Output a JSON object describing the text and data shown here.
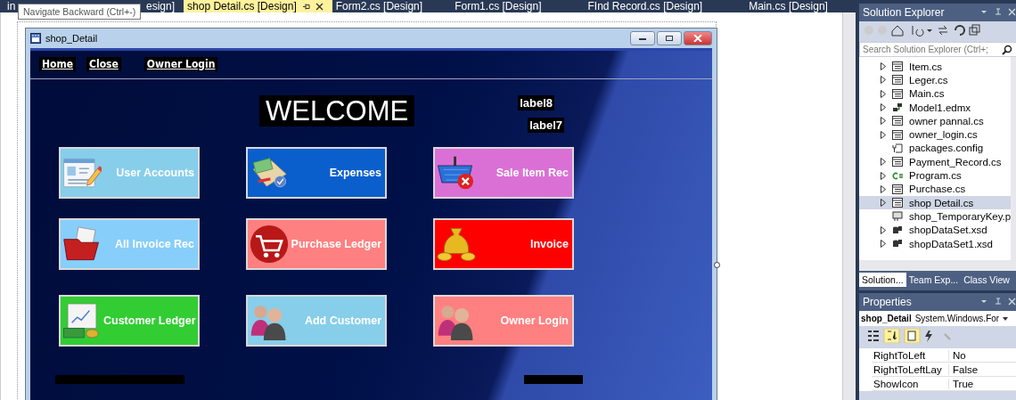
{
  "document_tabs": [
    {
      "label_start": "in",
      "label_end": "esign]",
      "selected": false
    },
    {
      "label": "shop Detail.cs [Design]",
      "selected": true
    },
    {
      "label": "Form2.cs [Design]",
      "selected": false
    },
    {
      "label": "Form1.cs [Design]",
      "selected": false
    },
    {
      "label": "FInd Record.cs [Design]",
      "selected": false
    },
    {
      "label": "Main.cs [Design]",
      "selected": false
    }
  ],
  "tooltip": "Navigate Backward (Ctrl+-)",
  "form": {
    "title": "shop_Detail",
    "menu": [
      "Home",
      "Close",
      "Owner Login"
    ],
    "welcome": "WELCOME",
    "label_a": "label8",
    "label_b": "label7",
    "buttons": [
      {
        "label": "User Accounts",
        "color": "#87ceeb",
        "kind": "card"
      },
      {
        "label": "Expenses",
        "color": "#0a5fcc",
        "kind": "envelope"
      },
      {
        "label": "Sale Item Rec",
        "color": "#da70d6",
        "kind": "basket"
      },
      {
        "label": "All Invoice Rec",
        "color": "#87cefa",
        "kind": "folder"
      },
      {
        "label": "Purchase Ledger",
        "color": "#ff8080",
        "kind": "cart"
      },
      {
        "label": "Invoice",
        "color": "#ff0000",
        "kind": "moneybag"
      },
      {
        "label": "Customer Ledger",
        "color": "#32cd32",
        "kind": "chart"
      },
      {
        "label": "Add Customer",
        "color": "#87ceeb",
        "kind": "people"
      },
      {
        "label": "Owner Login",
        "color": "#ff8080",
        "kind": "people"
      }
    ]
  },
  "solution_explorer": {
    "title": "Solution Explorer",
    "search": {
      "placeholder": "Search Solution Explorer (Ctrl+;"
    },
    "items": [
      {
        "name": "Item.cs",
        "kind": "form",
        "expandable": true,
        "selected": false
      },
      {
        "name": "Leger.cs",
        "kind": "form",
        "expandable": true,
        "selected": false
      },
      {
        "name": "Main.cs",
        "kind": "form",
        "expandable": true,
        "selected": false
      },
      {
        "name": "Model1.edmx",
        "kind": "model",
        "expandable": true,
        "selected": false
      },
      {
        "name": "owner pannal.cs",
        "kind": "form",
        "expandable": true,
        "selected": false
      },
      {
        "name": "owner_login.cs",
        "kind": "form",
        "expandable": true,
        "selected": false
      },
      {
        "name": "packages.config",
        "kind": "config",
        "expandable": false,
        "selected": false
      },
      {
        "name": "Payment_Record.cs",
        "kind": "form",
        "expandable": true,
        "selected": false
      },
      {
        "name": "Program.cs",
        "kind": "csharp",
        "expandable": true,
        "selected": false
      },
      {
        "name": "Purchase.cs",
        "kind": "form",
        "expandable": true,
        "selected": false
      },
      {
        "name": "shop Detail.cs",
        "kind": "form",
        "expandable": true,
        "selected": true
      },
      {
        "name": "shop_TemporaryKey.p",
        "kind": "key",
        "expandable": false,
        "selected": false
      },
      {
        "name": "shopDataSet.xsd",
        "kind": "dataset",
        "expandable": true,
        "selected": false
      },
      {
        "name": "shopDataSet1.xsd",
        "kind": "dataset",
        "expandable": true,
        "selected": false
      }
    ],
    "tabs": [
      {
        "label": "Solution...",
        "selected": true
      },
      {
        "label": "Team Exp...",
        "selected": false
      },
      {
        "label": "Class View",
        "selected": false
      }
    ]
  },
  "properties": {
    "title": "Properties",
    "object_name": "shop_Detail",
    "object_type": "System.Windows.For",
    "rows": [
      {
        "name": "RightToLeft",
        "value": "No"
      },
      {
        "name": "RightToLeftLay",
        "value": "False"
      },
      {
        "name": "ShowIcon",
        "value": "True"
      }
    ]
  }
}
